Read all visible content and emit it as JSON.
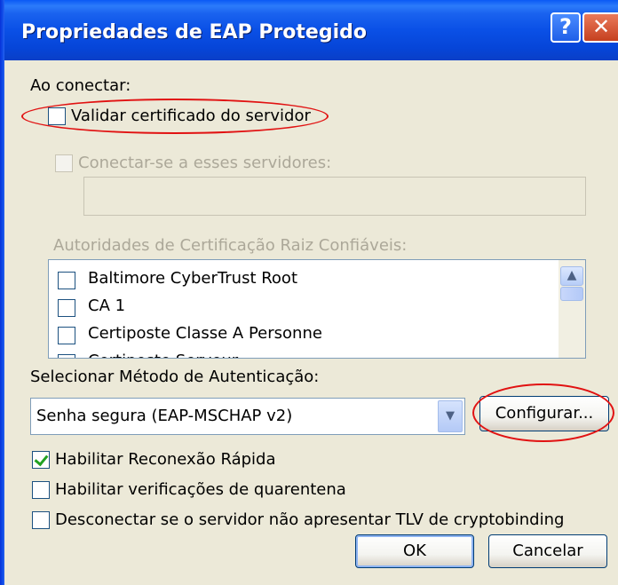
{
  "window": {
    "title": "Propriedades de EAP Protegido",
    "help_label": "?",
    "close_label": "✕"
  },
  "connect": {
    "heading": "Ao conectar:",
    "validate_cert_label": "Validar certificado do servidor",
    "validate_cert_checked": false,
    "connect_servers_label": "Conectar-se a esses servidores:",
    "servers_value": ""
  },
  "ca": {
    "heading": "Autoridades de Certificação Raiz Confiáveis:",
    "items": [
      {
        "label": "Baltimore CyberTrust Root",
        "checked": false
      },
      {
        "label": "CA 1",
        "checked": false
      },
      {
        "label": "Certiposte Classe A Personne",
        "checked": false
      },
      {
        "label": "Certiposte Serveur",
        "checked": false
      }
    ]
  },
  "auth": {
    "heading": "Selecionar Método de Autenticação:",
    "selected_method": "Senha segura (EAP-MSCHAP v2)",
    "configure_label": "Configurar..."
  },
  "options": [
    {
      "label": "Habilitar Reconexão Rápida",
      "checked": true
    },
    {
      "label": "Habilitar verificações de quarentena",
      "checked": false
    },
    {
      "label": "Desconectar se o servidor não apresentar TLV de cryptobinding",
      "checked": false
    }
  ],
  "footer": {
    "ok_label": "OK",
    "cancel_label": "Cancelar"
  },
  "colors": {
    "titlebar": "#0a50e6",
    "dialog_bg": "#ece9d8",
    "annotation": "#e11212",
    "check": "#21a121"
  }
}
